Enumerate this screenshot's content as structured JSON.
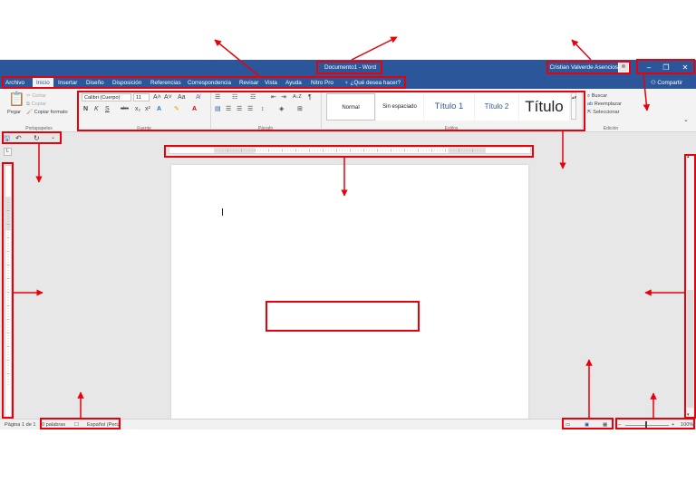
{
  "window": {
    "doc_title": "Documento1 - Word",
    "user_name": "Cristian Valverde Asencios",
    "minimize": "–",
    "restore": "❐",
    "close": "✕"
  },
  "tabs": [
    "Archivo",
    "Inicio",
    "Insertar",
    "Diseño",
    "Disposición",
    "Referencias",
    "Correspondencia",
    "Revisar",
    "Vista",
    "Ayuda",
    "Nitro Pro"
  ],
  "tell_me": "¿Qué desea hacer?",
  "share": "Compartir",
  "ribbon": {
    "clipboard": {
      "paste": "Pegar",
      "cut": "Cortar",
      "copy": "Copiar",
      "format_painter": "Copiar formato",
      "label": "Portapapeles"
    },
    "font": {
      "name": "Calibri (Cuerpo)",
      "size": "11",
      "grow": "A˄",
      "shrink": "A˅",
      "case": "Aa",
      "bold": "N",
      "italic": "K",
      "underline": "S",
      "strike": "abc",
      "sub": "x₂",
      "sup": "x²",
      "label": "Fuente"
    },
    "paragraph": {
      "label": "Párrafo",
      "sort": "A↓Z",
      "pilcrow": "¶"
    },
    "styles": {
      "items": [
        "Normal",
        "Sin espaciado",
        "Título 1",
        "Título 2",
        "Título"
      ],
      "label": "Estilos"
    },
    "editing": {
      "find": "Buscar",
      "replace": "Reemplazar",
      "select": "Seleccionar",
      "label": "Edición"
    }
  },
  "qat": {
    "save_icon": "save-icon",
    "undo_icon": "undo-icon",
    "redo_icon": "redo-icon"
  },
  "status": {
    "page": "Página 1 de 1",
    "words": "0 palabras",
    "language": "Español (Perú)",
    "zoom": "100%"
  },
  "colors": {
    "title_bar": "#2b579a",
    "annotation": "#e8000b",
    "ribbon": "#f3f3f3",
    "workspace": "#e7e7e7"
  }
}
